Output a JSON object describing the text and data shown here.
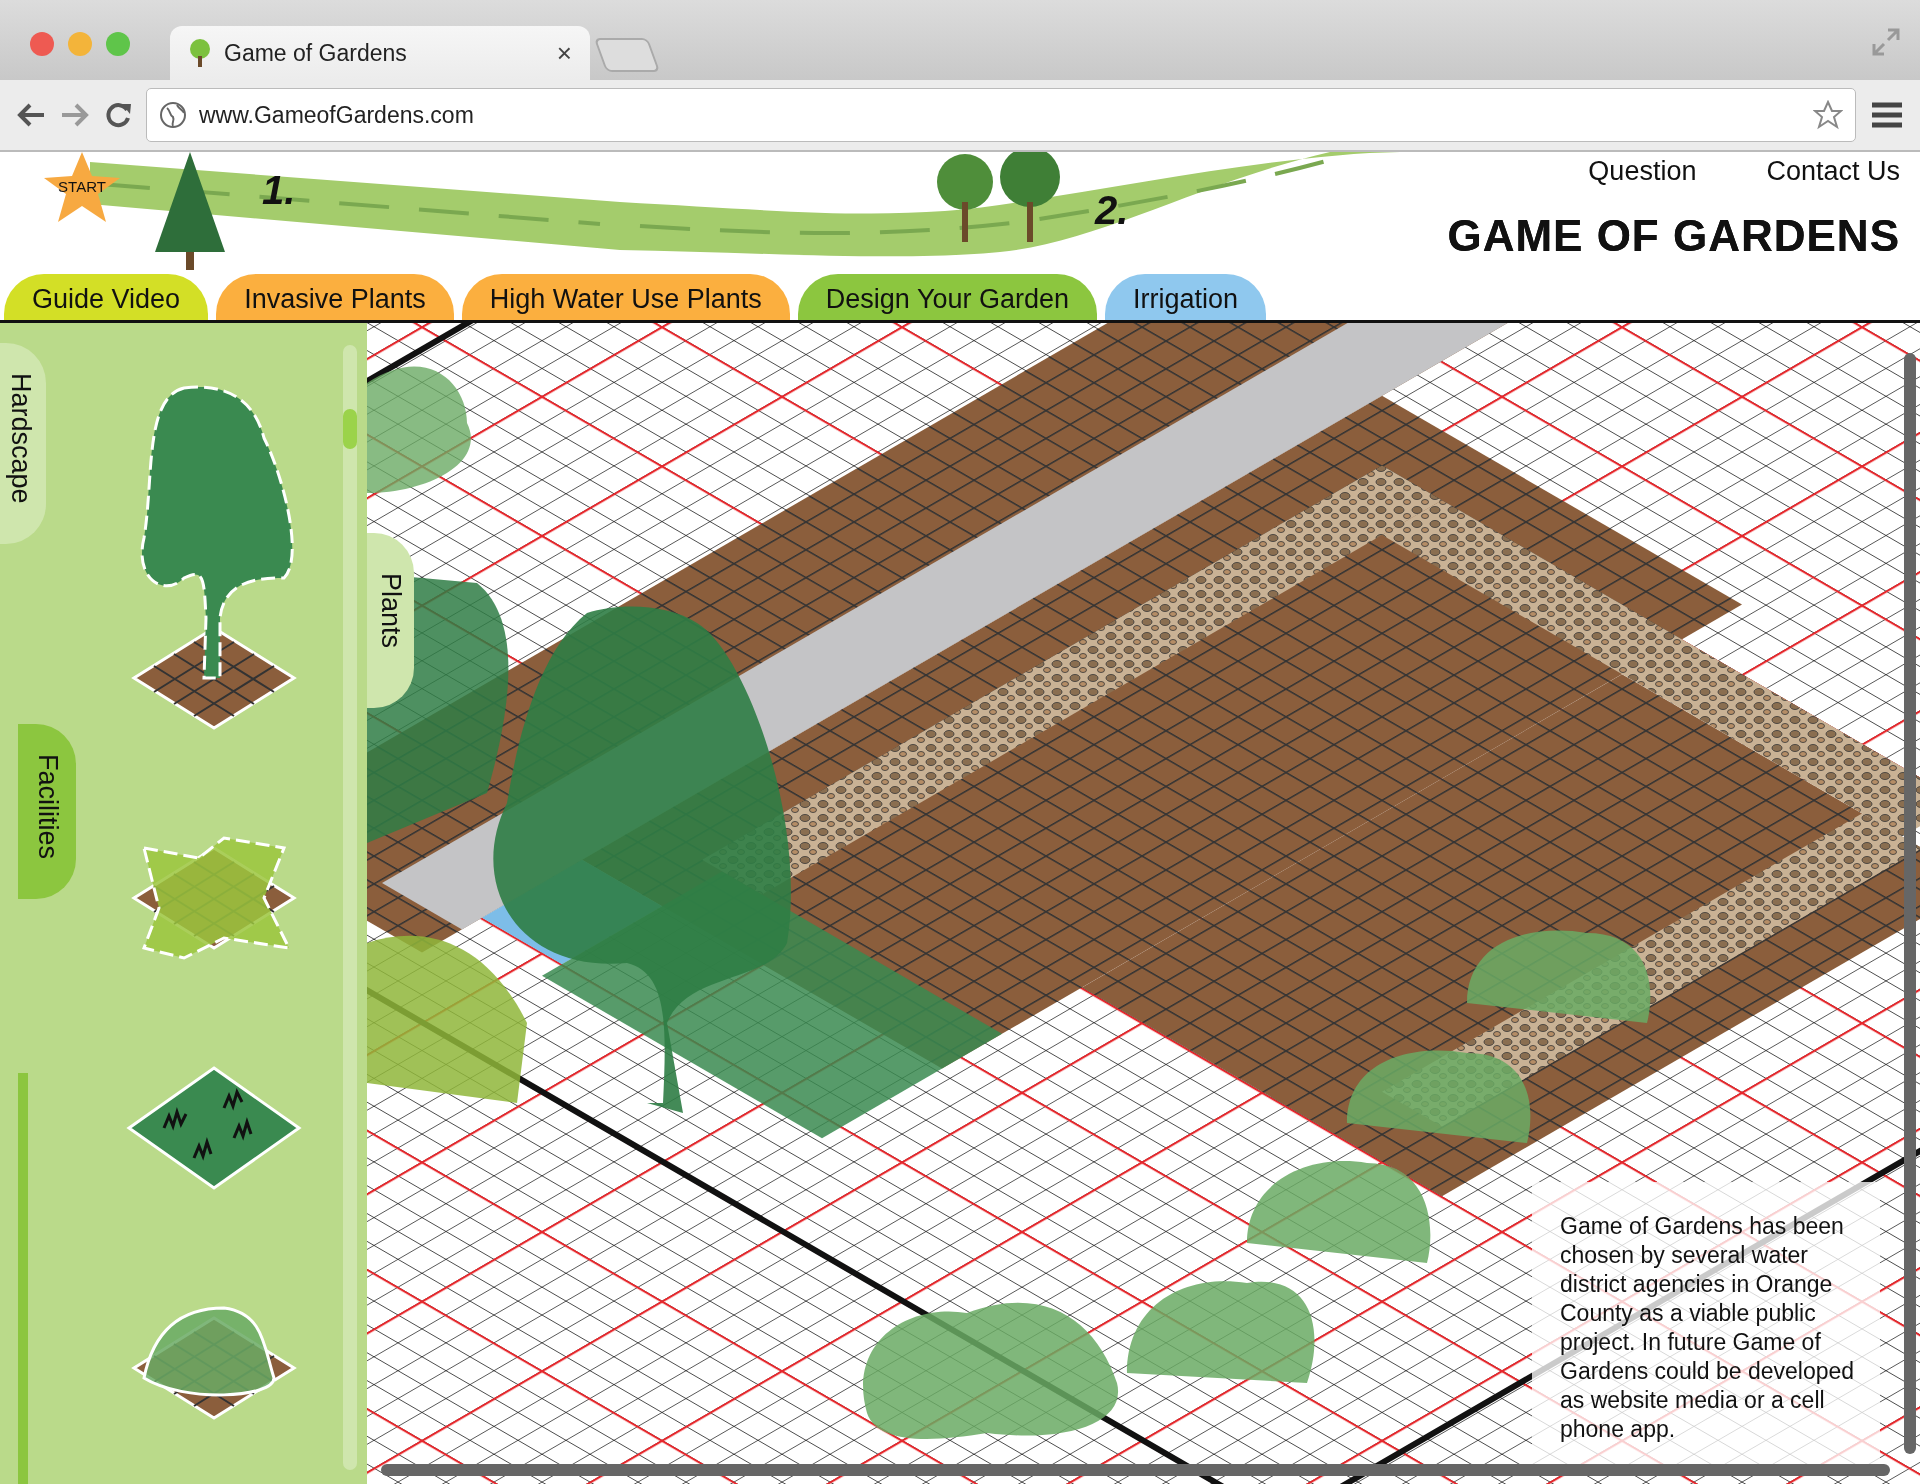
{
  "browser": {
    "tab_title": "Game of Gardens",
    "tab_close": "×",
    "url": "www.GameofGardens.com"
  },
  "roadmap": {
    "start": "START",
    "steps": [
      "1.",
      "2."
    ]
  },
  "header_links": [
    "Question",
    "Contact Us"
  ],
  "logo": "GAME OF GARDENS",
  "nav_tabs": [
    {
      "label": "Guide Video",
      "color": "#d3df26"
    },
    {
      "label": "Invasive Plants",
      "color": "#fbaf3f"
    },
    {
      "label": "High Water Use Plants",
      "color": "#fbaf3f"
    },
    {
      "label": "Design Your Garden",
      "color": "#8cc63f"
    },
    {
      "label": "Irrigation",
      "color": "#8fc8ee"
    }
  ],
  "side_tabs": [
    {
      "label": "Hardscape",
      "selected": false
    },
    {
      "label": "Facilities",
      "selected": true
    }
  ],
  "plants_tab": {
    "label": "Plants"
  },
  "palette": [
    {
      "kind": "tree"
    },
    {
      "kind": "hedge"
    },
    {
      "kind": "grass"
    },
    {
      "kind": "shrub"
    }
  ],
  "info_text": "Game of Gardens has been chosen by several water district agencies in Orange County as a viable public project. In future Game of Gardens could be developed as website media or a cell phone app."
}
